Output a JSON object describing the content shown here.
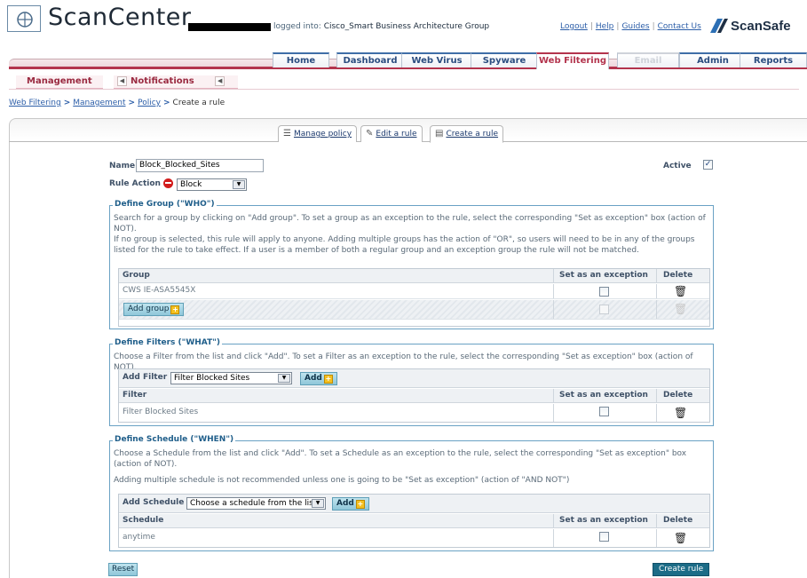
{
  "header": {
    "app_title": "ScanCenter",
    "logged_into_label": "logged into:",
    "org_name": "Cisco_Smart Business Architecture Group",
    "links": [
      "Logout",
      "Help",
      "Guides",
      "Contact Us"
    ],
    "brand": "ScanSafe"
  },
  "nav": {
    "tabs": [
      {
        "label": "Home",
        "state": "normal"
      },
      {
        "label": "Dashboard",
        "state": "normal"
      },
      {
        "label": "Web Virus",
        "state": "normal"
      },
      {
        "label": "Spyware",
        "state": "normal"
      },
      {
        "label": "Web Filtering",
        "state": "active"
      },
      {
        "label": "Email",
        "state": "disabled"
      },
      {
        "label": "Admin",
        "state": "normal"
      },
      {
        "label": "Reports",
        "state": "normal"
      }
    ]
  },
  "subnav": {
    "items": [
      "Management",
      "Notifications"
    ]
  },
  "breadcrumb": [
    "Web Filtering",
    "Management",
    "Policy",
    "Create a rule"
  ],
  "subtabs": [
    {
      "label": "Manage policy",
      "icon": "list-icon"
    },
    {
      "label": "Edit a rule",
      "icon": "edit-icon"
    },
    {
      "label": "Create a rule",
      "icon": "add-rule-icon"
    }
  ],
  "form": {
    "name_label": "Name",
    "name_value": "Block_Blocked_Sites",
    "rule_action_label": "Rule Action",
    "rule_action_value": "Block",
    "active_label": "Active",
    "active_checked": true
  },
  "group_section": {
    "title": "Define Group (\"WHO\")",
    "desc1": "Search for a group by clicking on \"Add group\". To set a group as an exception to the rule, select the corresponding \"Set as exception\" box (action of NOT).",
    "desc2": "If no group is selected, this rule will apply to anyone. Adding multiple groups has the action of \"OR\", so users will need to be in any of the groups listed for the rule to take effect. If a user is a member of both a regular group and an exception group the rule will not be matched.",
    "col_name": "Group",
    "col_exception": "Set as an exception",
    "col_delete": "Delete",
    "rows": [
      "CWS IE-ASA5545X"
    ],
    "add_button": "Add group"
  },
  "filter_section": {
    "title": "Define Filters (\"WHAT\")",
    "desc": "Choose a Filter from the list and click \"Add\". To set a Filter as an exception to the rule, select the corresponding \"Set as exception\" box (action of NOT).",
    "add_label": "Add Filter",
    "select_value": "Filter Blocked Sites",
    "add_button": "Add",
    "col_name": "Filter",
    "col_exception": "Set as an exception",
    "col_delete": "Delete",
    "rows": [
      "Filter Blocked Sites"
    ]
  },
  "schedule_section": {
    "title": "Define Schedule (\"WHEN\")",
    "desc1": "Choose a Schedule from the list and click \"Add\". To set a Schedule as an exception to the rule, select the corresponding \"Set as exception\" box (action of NOT).",
    "desc2": "Adding multiple schedule is not recommended unless one is going to be \"Set as exception\" (action of \"AND NOT\")",
    "add_label": "Add Schedule",
    "select_value": "Choose a schedule from the list",
    "add_button": "Add",
    "col_name": "Schedule",
    "col_exception": "Set as an exception",
    "col_delete": "Delete",
    "rows": [
      "anytime"
    ]
  },
  "actions": {
    "reset": "Reset",
    "create": "Create rule"
  },
  "colors": {
    "accent_red": "#b3344d",
    "accent_blue": "#2b4d80",
    "section_border": "#6aa2c4",
    "button_dark": "#1c6c87"
  }
}
